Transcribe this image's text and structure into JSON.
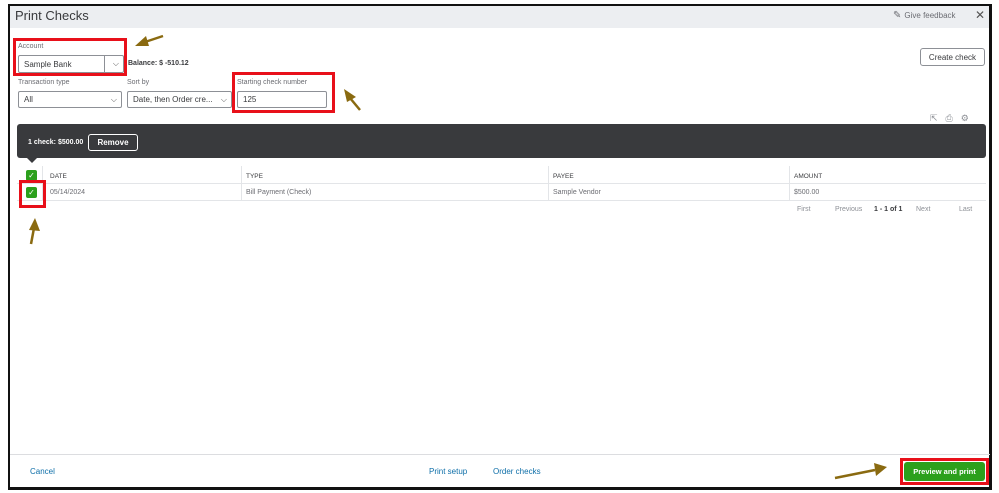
{
  "dialog": {
    "title": "Print Checks",
    "feedback_label": "Give feedback",
    "close_icon": "close-icon"
  },
  "filters": {
    "account_label": "Account",
    "account_value": "Sample Bank",
    "balance": "Balance: $ -510.12",
    "transaction_type_label": "Transaction type",
    "transaction_type_value": "All",
    "sort_by_label": "Sort by",
    "sort_by_value": "Date, then Order cre...",
    "starting_check_label": "Starting check number",
    "starting_check_value": "125"
  },
  "create_check_label": "Create check",
  "selection_bar": {
    "summary": "1 check: $500.00",
    "remove_label": "Remove"
  },
  "table": {
    "headers": [
      "DATE",
      "TYPE",
      "PAYEE",
      "AMOUNT"
    ],
    "rows": [
      {
        "date": "05/14/2024",
        "type": "Bill Payment (Check)",
        "payee": "Sample Vendor",
        "amount": "$500.00",
        "checked": true
      }
    ]
  },
  "pagination": {
    "first": "First",
    "previous": "Previous",
    "range": "1 - 1 of 1",
    "next": "Next",
    "last": "Last"
  },
  "footer": {
    "cancel": "Cancel",
    "print_setup": "Print setup",
    "order_checks": "Order checks",
    "preview_print": "Preview and print"
  },
  "colors": {
    "accent_green": "#2ca01c",
    "annotation_red": "#e8101a",
    "annotation_arrow": "#8a6a10",
    "dark_bar": "#393a3d"
  }
}
